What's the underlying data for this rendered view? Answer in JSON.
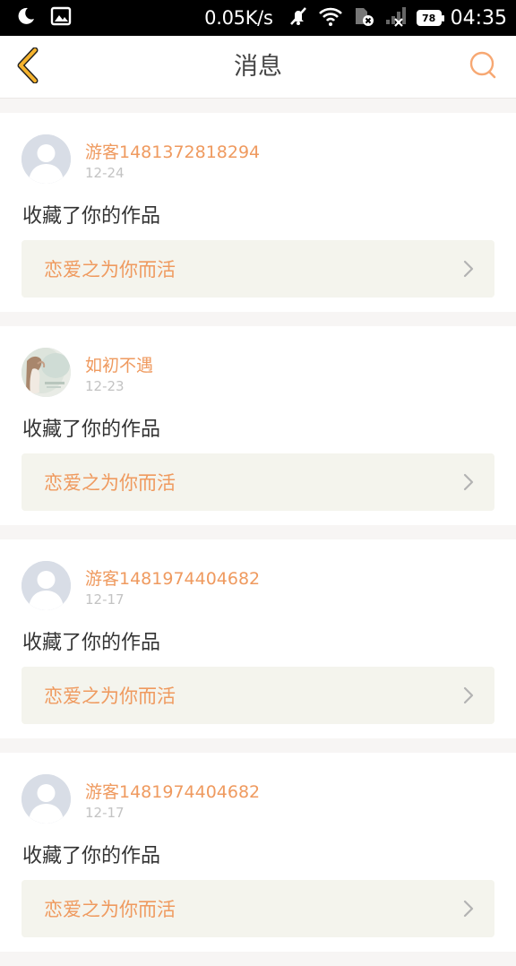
{
  "status_bar": {
    "net_speed": "0.05K/s",
    "battery": "78",
    "time": "04:35"
  },
  "header": {
    "title": "消息"
  },
  "messages": [
    {
      "user": "游客1481372818294",
      "date": "12-24",
      "action": "收藏了你的作品",
      "work_title": "恋爱之为你而活",
      "avatar": "default-avatar"
    },
    {
      "user": "如初不遇",
      "date": "12-23",
      "action": "收藏了你的作品",
      "work_title": "恋爱之为你而活",
      "avatar": "photo-avatar"
    },
    {
      "user": "游客1481974404682",
      "date": "12-17",
      "action": "收藏了你的作品",
      "work_title": "恋爱之为你而活",
      "avatar": "default-avatar"
    },
    {
      "user": "游客1481974404682",
      "date": "12-17",
      "action": "收藏了你的作品",
      "work_title": "恋爱之为你而活",
      "avatar": "default-avatar"
    }
  ],
  "colors": {
    "accent": "#ef9a5f",
    "back_icon": "#f5b32e",
    "search_icon": "#f7a873",
    "card_link_bg": "#f4f4ed"
  }
}
